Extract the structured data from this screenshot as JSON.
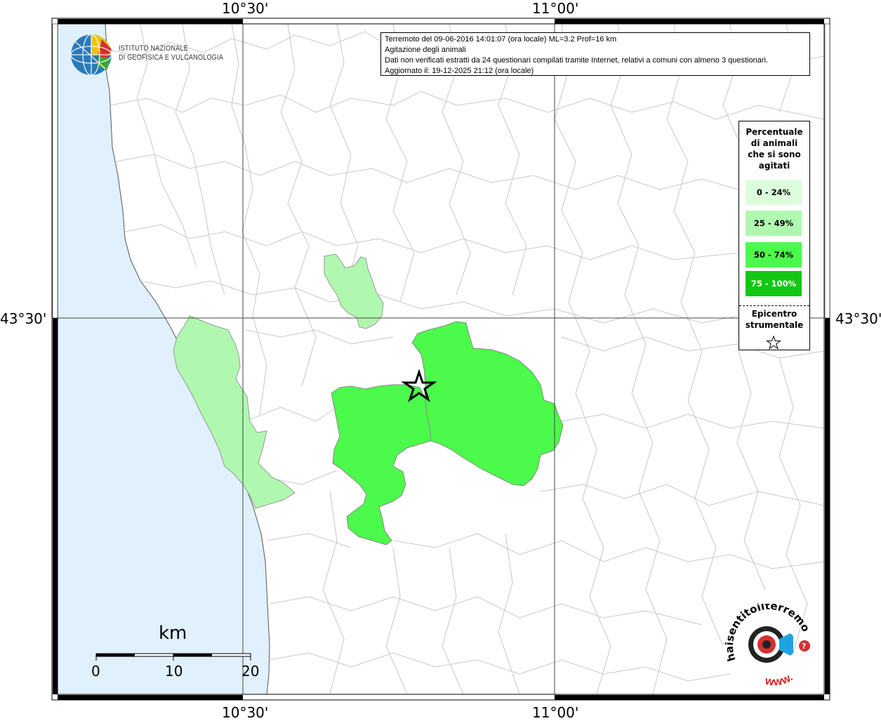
{
  "axes": {
    "top_labels": [
      "10°30'",
      "11°00'"
    ],
    "bottom_labels": [
      "10°30'",
      "11°00'"
    ],
    "left_label": "43°30'",
    "right_label": "43°30'"
  },
  "info": {
    "line1": "Terremoto del 09-06-2016 14:01:07 (ora locale) ML=3.2 Prof=16 km",
    "line2": "Agitazione degli animali",
    "line3": "Dati non verificati estratti da 24 questionari compilati tramite Internet, relativi a comuni con almeno 3 questionari.",
    "line4": "Aggiornato il: 19-12-2025 21:12 (ora locale)"
  },
  "logo": {
    "line1": "ISTITUTO NAZIONALE",
    "line2": "DI GEOFISICA E VULCANOLOGIA"
  },
  "legend": {
    "title_lines": [
      "Percentuale",
      "di animali",
      "che si sono",
      "agitati"
    ],
    "items": [
      {
        "label": "0 - 24%",
        "color": "#ddfedd"
      },
      {
        "label": "25 - 49%",
        "color": "#b0f8b0"
      },
      {
        "label": "50 - 74%",
        "color": "#4cfa4c"
      },
      {
        "label": "75 - 100%",
        "color": "#12c812"
      }
    ],
    "epicenter_lines": [
      "Epicentro",
      "strumentale"
    ]
  },
  "scale": {
    "unit": "km",
    "ticks": [
      "0",
      "10",
      "20"
    ]
  },
  "watermark": {
    "text": "haisentitoilterremoto.it",
    "url": "WWW."
  },
  "colors": {
    "sea": "#e0f0fc",
    "land": "#ffffff",
    "border": "#c8c8c8",
    "class_25_49": "#b0f8b0",
    "class_50_74": "#4cfa4c"
  }
}
